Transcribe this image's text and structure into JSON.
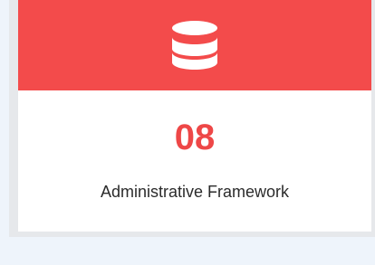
{
  "card": {
    "icon": "database-icon",
    "number": "08",
    "label": "Administrative Framework",
    "header_color": "#f34b4b",
    "number_color": "#ee4747"
  }
}
